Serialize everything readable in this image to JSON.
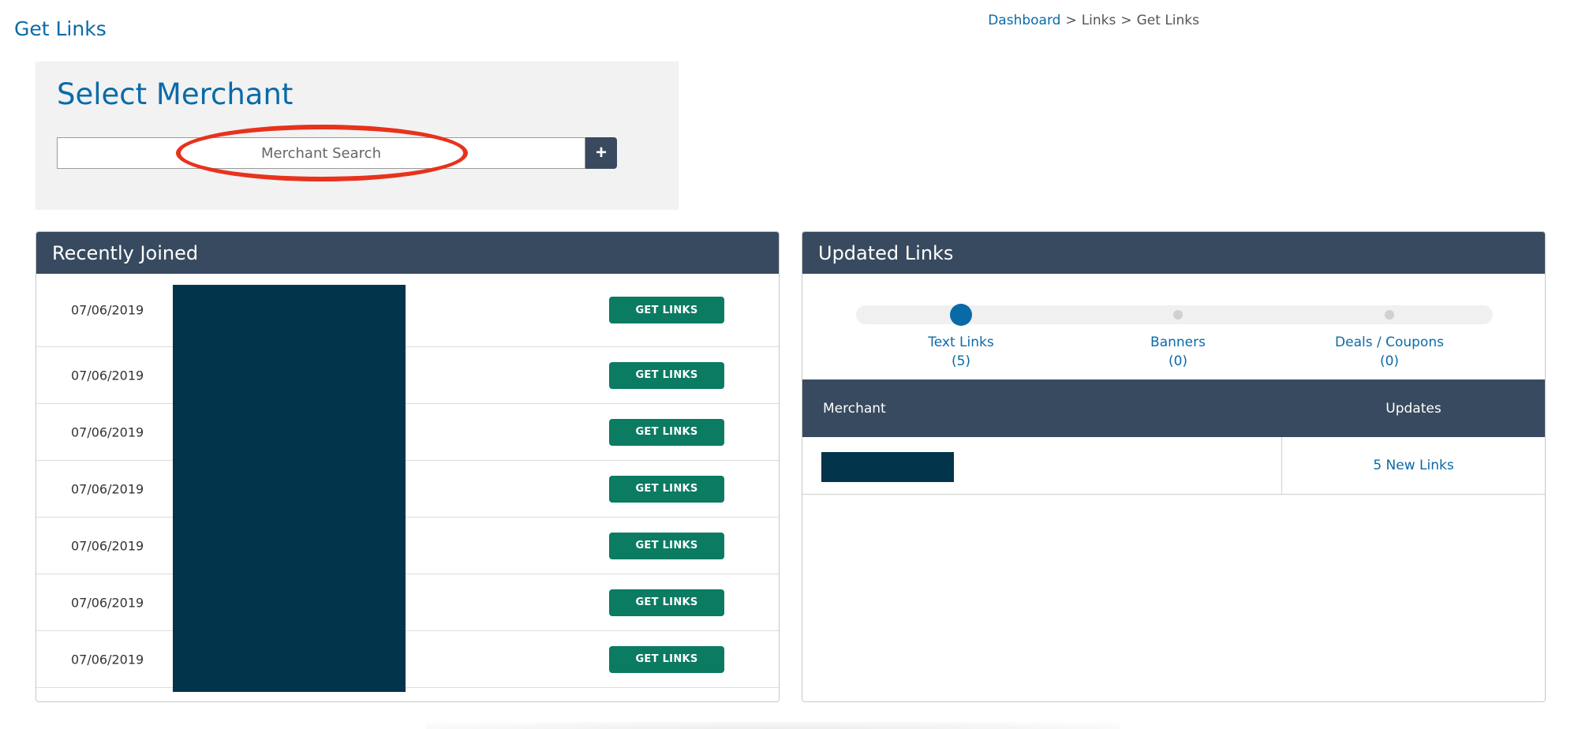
{
  "page": {
    "title": "Get Links"
  },
  "breadcrumb": {
    "items": [
      "Dashboard",
      "Links",
      "Get Links"
    ],
    "separator": ">"
  },
  "merchant_search": {
    "heading": "Select Merchant",
    "placeholder": "Merchant Search",
    "add_button_icon": "+",
    "icon_name": "plus-icon"
  },
  "recently_joined": {
    "title": "Recently Joined",
    "button_label": "GET LINKS",
    "rows": [
      {
        "date": "07/06/2019"
      },
      {
        "date": "07/06/2019"
      },
      {
        "date": "07/06/2019"
      },
      {
        "date": "07/06/2019"
      },
      {
        "date": "07/06/2019"
      },
      {
        "date": "07/06/2019"
      },
      {
        "date": "07/06/2019"
      }
    ]
  },
  "updated_links": {
    "title": "Updated Links",
    "tabs": [
      {
        "label": "Text Links",
        "count": "(5)",
        "active": true
      },
      {
        "label": "Banners",
        "count": "(0)",
        "active": false
      },
      {
        "label": "Deals / Coupons",
        "count": "(0)",
        "active": false
      }
    ],
    "table": {
      "headers": {
        "merchant": "Merchant",
        "updates": "Updates"
      },
      "rows": [
        {
          "updates": "5 New Links"
        }
      ]
    }
  },
  "colors": {
    "brand_blue": "#0a6aa8",
    "header_dark": "#384a5f",
    "button_green": "#0b7b62",
    "redaction": "#02354b",
    "highlight_red": "#e8321c"
  }
}
